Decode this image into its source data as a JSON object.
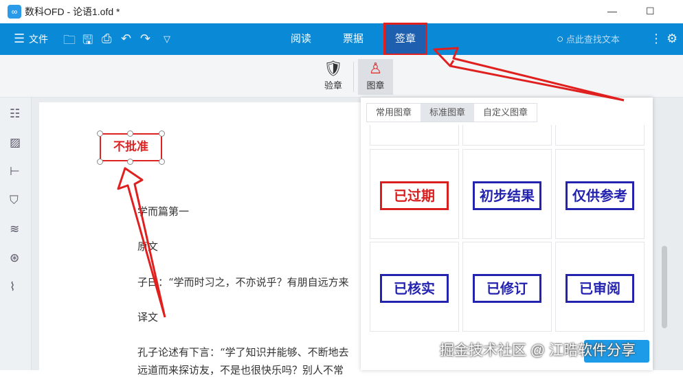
{
  "window": {
    "title": "数科OFD - 论语1.ofd *",
    "minimize": "—",
    "maximize": "☐"
  },
  "toolbar": {
    "file": "文件",
    "tabs": [
      "阅读",
      "票据",
      "签章"
    ],
    "search_placeholder": "点此查找文本"
  },
  "ribbon": {
    "verify": "验章",
    "stamp": "图章"
  },
  "document": {
    "selected_stamp": "不批准",
    "lines": [
      "学而篇第一",
      "原文",
      "子曰：“学而时习之，不亦说乎？有朋自远方来",
      "译文",
      "孔子论述有下言：“学了知识并能够、不断地去",
      "远道而来探访友，不是也很快乐吗？别人不常"
    ]
  },
  "stamp_panel": {
    "tabs": [
      "常用图章",
      "标准图章",
      "自定义图章"
    ],
    "active_tab": "标准图章",
    "stamps": [
      {
        "text": "已过期",
        "color": "#d91e1e"
      },
      {
        "text": "初步结果",
        "color": "#2323b0"
      },
      {
        "text": "仅供参考",
        "color": "#2323b0"
      },
      {
        "text": "已核实",
        "color": "#2323b0"
      },
      {
        "text": "已修订",
        "color": "#2323b0"
      },
      {
        "text": "已审阅",
        "color": "#2323b0"
      }
    ]
  },
  "watermark": "掘金技术社区 @ 江晧软件分享"
}
